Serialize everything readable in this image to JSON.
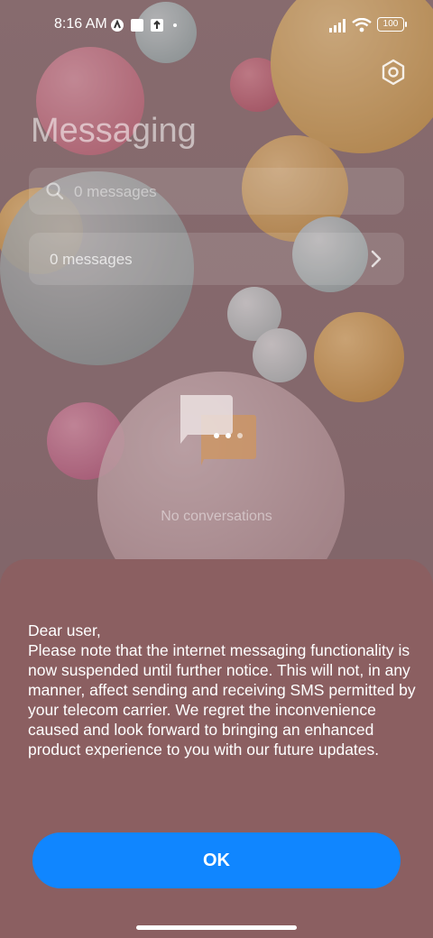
{
  "status_bar": {
    "time": "8:16 AM",
    "battery": "100"
  },
  "app": {
    "title": "Messaging",
    "search_placeholder": "0 messages",
    "row_label": "0 messages",
    "empty_text": "No conversations"
  },
  "dialog": {
    "message": "Dear user,\nPlease note that the internet messaging functionality is now suspended until further notice. This will not, in any manner, affect sending and receiving SMS permitted by your telecom carrier. We regret the inconvenience caused and look forward to bringing an enhanced product experience to you with our future updates.",
    "ok_label": "OK"
  },
  "colors": {
    "accent": "#1086ff",
    "sheet": "#8b5f61"
  },
  "icons": [
    "settings-gear-icon",
    "search-icon",
    "chevron-right-icon",
    "chat-bubbles-icon",
    "signal-icon",
    "wifi-icon",
    "battery-icon"
  ]
}
